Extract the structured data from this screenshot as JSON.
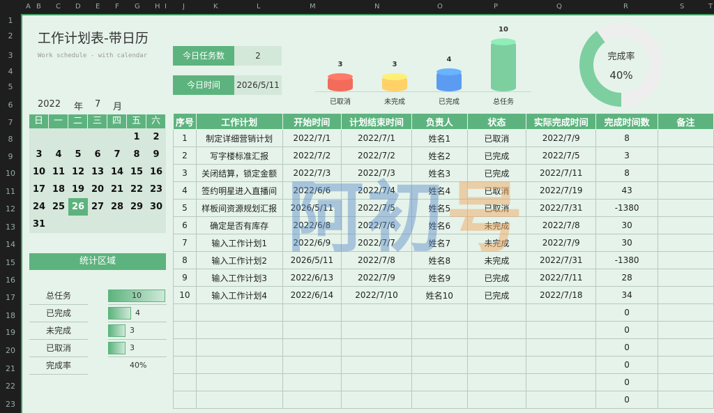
{
  "columns": [
    "A",
    "B",
    "C",
    "D",
    "E",
    "F",
    "G",
    "H",
    "I",
    "J",
    "K",
    "L",
    "M",
    "N",
    "O",
    "P",
    "Q",
    "R",
    "S",
    "T"
  ],
  "rows": [
    "1",
    "2",
    "3",
    "4",
    "5",
    "6",
    "7",
    "8",
    "9",
    "10",
    "11",
    "12",
    "13",
    "14",
    "15",
    "16",
    "17",
    "18",
    "19",
    "20",
    "21",
    "22",
    "23"
  ],
  "title": "工作计划表-带日历",
  "subtitle": "Work schedule - with calendar",
  "kpi": {
    "today_tasks_label": "今日任务数",
    "today_tasks_value": "2",
    "today_time_label": "今日时间",
    "today_time_value": "2026/5/11"
  },
  "calendar": {
    "year": "2022",
    "year_label": "年",
    "month": "7",
    "month_label": "月",
    "weekdays": [
      "日",
      "一",
      "二",
      "三",
      "四",
      "五",
      "六"
    ],
    "weeks": [
      [
        "",
        "",
        "",
        "",
        "",
        "1",
        "2"
      ],
      [
        "3",
        "4",
        "5",
        "6",
        "7",
        "8",
        "9"
      ],
      [
        "10",
        "11",
        "12",
        "13",
        "14",
        "15",
        "16"
      ],
      [
        "17",
        "18",
        "19",
        "20",
        "21",
        "22",
        "23"
      ],
      [
        "24",
        "25",
        "26",
        "27",
        "28",
        "29",
        "30"
      ],
      [
        "31",
        "",
        "",
        "",
        "",
        "",
        ""
      ]
    ],
    "today": "26"
  },
  "stats": {
    "title": "统计区域",
    "items": [
      {
        "label": "总任务",
        "value": "10",
        "fraction": 1.0
      },
      {
        "label": "已完成",
        "value": "4",
        "fraction": 0.4
      },
      {
        "label": "未完成",
        "value": "3",
        "fraction": 0.3
      },
      {
        "label": "已取消",
        "value": "3",
        "fraction": 0.3
      }
    ],
    "rate_label": "完成率",
    "rate_value": "40%"
  },
  "chart_data": [
    {
      "type": "bar",
      "categories": [
        "已取消",
        "未完成",
        "已完成",
        "总任务"
      ],
      "values": [
        3,
        3,
        4,
        10
      ],
      "colors": [
        "#f26b5b",
        "#ffd166",
        "#5b9cf2",
        "#7dcf9f"
      ],
      "ylim": [
        0,
        10
      ]
    },
    {
      "type": "pie",
      "title": "完成率",
      "values": [
        40,
        60
      ],
      "center_label": "40%",
      "colors": [
        "#7dcf9f",
        "#eeeeee"
      ]
    }
  ],
  "table": {
    "headers": [
      "序号",
      "工作计划",
      "开始时间",
      "计划结束时间",
      "负责人",
      "状态",
      "实际完成时间",
      "完成时间数",
      "备注"
    ],
    "rows": [
      [
        "1",
        "制定详细营销计划",
        "2022/7/1",
        "2022/7/1",
        "姓名1",
        "已取消",
        "2022/7/9",
        "8",
        ""
      ],
      [
        "2",
        "写字楼标准汇报",
        "2022/7/2",
        "2022/7/2",
        "姓名2",
        "已完成",
        "2022/7/5",
        "3",
        ""
      ],
      [
        "3",
        "关闭结算，锁定金额",
        "2022/7/3",
        "2022/7/3",
        "姓名3",
        "已完成",
        "2022/7/11",
        "8",
        ""
      ],
      [
        "4",
        "签约明星进入直播间",
        "2022/6/6",
        "2022/7/4",
        "姓名4",
        "已取消",
        "2022/7/19",
        "43",
        ""
      ],
      [
        "5",
        "样板间资源规划汇报",
        "2026/5/11",
        "2022/7/5",
        "姓名5",
        "已取消",
        "2022/7/31",
        "-1380",
        ""
      ],
      [
        "6",
        "确定是否有库存",
        "2022/6/8",
        "2022/7/6",
        "姓名6",
        "未完成",
        "2022/7/8",
        "30",
        ""
      ],
      [
        "7",
        "输入工作计划1",
        "2022/6/9",
        "2022/7/7",
        "姓名7",
        "未完成",
        "2022/7/9",
        "30",
        ""
      ],
      [
        "8",
        "输入工作计划2",
        "2026/5/11",
        "2022/7/8",
        "姓名8",
        "未完成",
        "2022/7/31",
        "-1380",
        ""
      ],
      [
        "9",
        "输入工作计划3",
        "2022/6/13",
        "2022/7/9",
        "姓名9",
        "已完成",
        "2022/7/11",
        "28",
        ""
      ],
      [
        "10",
        "输入工作计划4",
        "2022/6/14",
        "2022/7/10",
        "姓名10",
        "已完成",
        "2022/7/18",
        "34",
        ""
      ],
      [
        "",
        "",
        "",
        "",
        "",
        "",
        "",
        "0",
        ""
      ],
      [
        "",
        "",
        "",
        "",
        "",
        "",
        "",
        "0",
        ""
      ],
      [
        "",
        "",
        "",
        "",
        "",
        "",
        "",
        "0",
        ""
      ],
      [
        "",
        "",
        "",
        "",
        "",
        "",
        "",
        "0",
        ""
      ],
      [
        "",
        "",
        "",
        "",
        "",
        "",
        "",
        "0",
        ""
      ],
      [
        "",
        "",
        "",
        "",
        "",
        "",
        "",
        "0",
        ""
      ]
    ]
  },
  "watermark": [
    "阿",
    "初",
    "号"
  ]
}
